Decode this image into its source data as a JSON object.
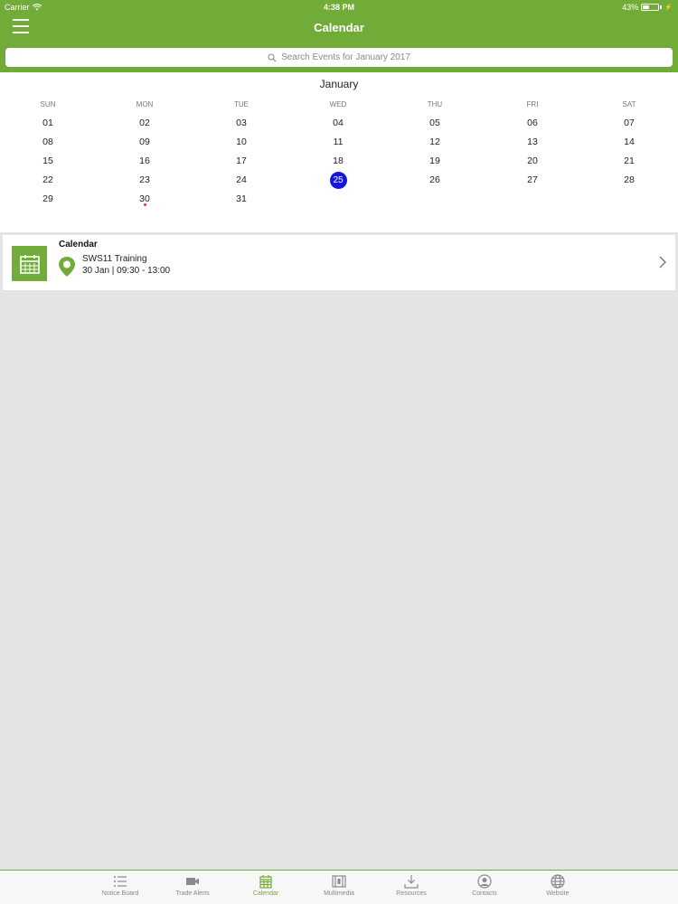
{
  "status_bar": {
    "carrier": "Carrier",
    "time": "4:38 PM",
    "battery": "43%",
    "battery_level": 0.43
  },
  "header": {
    "title": "Calendar"
  },
  "search": {
    "placeholder": "Search Events for January 2017"
  },
  "calendar": {
    "month": "January",
    "weekdays": [
      "SUN",
      "MON",
      "TUE",
      "WED",
      "THU",
      "FRI",
      "SAT"
    ],
    "weeks": [
      [
        "01",
        "02",
        "03",
        "04",
        "05",
        "06",
        "07"
      ],
      [
        "08",
        "09",
        "10",
        "11",
        "12",
        "13",
        "14"
      ],
      [
        "15",
        "16",
        "17",
        "18",
        "19",
        "20",
        "21"
      ],
      [
        "22",
        "23",
        "24",
        "25",
        "26",
        "27",
        "28"
      ],
      [
        "29",
        "30",
        "31",
        "",
        "",
        "",
        ""
      ]
    ],
    "today": "25",
    "event_days": [
      "30"
    ],
    "today_color": "#1414e0"
  },
  "events": [
    {
      "category": "Calendar",
      "title": "SWS11 Training",
      "datetime": "30 Jan | 09:30 - 13:00"
    }
  ],
  "tabs": [
    {
      "label": "Notice Board",
      "icon": "list-icon",
      "active": false
    },
    {
      "label": "Trade Alerts",
      "icon": "video-camera-icon",
      "active": false
    },
    {
      "label": "Calendar",
      "icon": "calendar-icon",
      "active": true
    },
    {
      "label": "Multimedia",
      "icon": "film-icon",
      "active": false
    },
    {
      "label": "Resources",
      "icon": "download-icon",
      "active": false
    },
    {
      "label": "Contacts",
      "icon": "contact-icon",
      "active": false
    },
    {
      "label": "Website",
      "icon": "globe-icon",
      "active": false
    }
  ],
  "colors": {
    "accent": "#72ac38",
    "background": "#e4e4e6"
  }
}
